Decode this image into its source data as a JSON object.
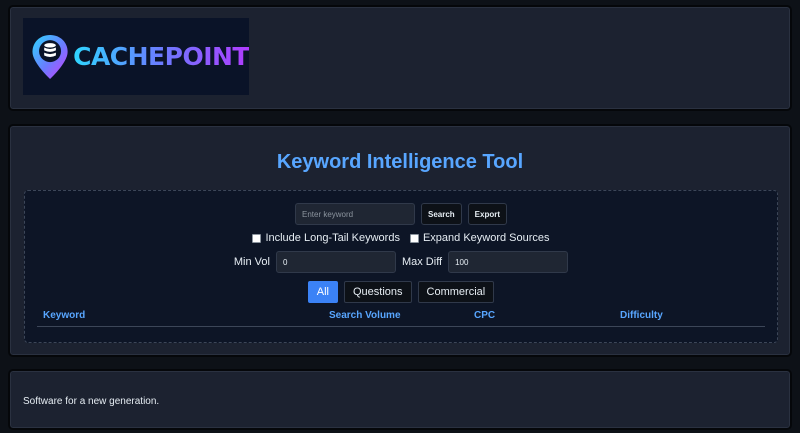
{
  "brand": {
    "name": "CACHEPOINT",
    "icon": "database-pin-icon",
    "colors": [
      "#2fd6ff",
      "#6b7bff",
      "#b03cff"
    ]
  },
  "tool": {
    "title": "Keyword Intelligence Tool",
    "keyword_input": {
      "value": "",
      "placeholder": "Enter keyword"
    },
    "search_label": "Search",
    "export_label": "Export",
    "long_tail": {
      "label": "Include Long-Tail Keywords",
      "checked": false
    },
    "expand_sources": {
      "label": "Expand Keyword Sources",
      "checked": false
    },
    "min_vol": {
      "label": "Min Vol",
      "value": "0"
    },
    "max_diff": {
      "label": "Max Diff",
      "value": "100"
    },
    "tabs": [
      {
        "label": "All",
        "active": true
      },
      {
        "label": "Questions",
        "active": false
      },
      {
        "label": "Commercial",
        "active": false
      }
    ],
    "columns": [
      "Keyword",
      "Search Volume",
      "CPC",
      "Difficulty"
    ]
  },
  "footer": {
    "text": "Software for a new generation."
  },
  "theme": {
    "accent": "#58a6ff",
    "active_tab": "#3b82f6",
    "panel_bg": "#1c2230"
  }
}
